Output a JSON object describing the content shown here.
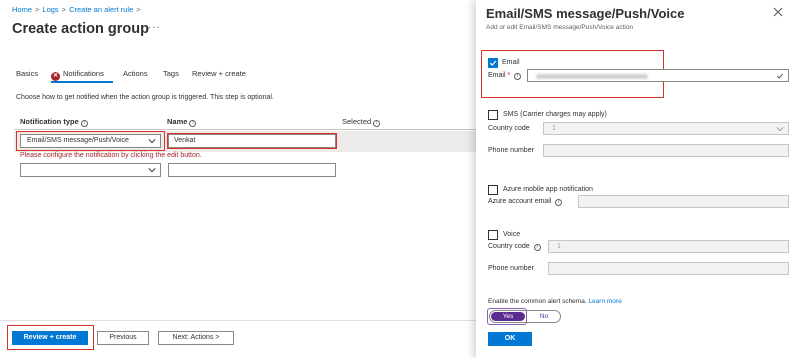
{
  "breadcrumb": {
    "items": [
      "Home",
      "Logs",
      "Create an alert rule"
    ]
  },
  "page": {
    "title": "Create action group",
    "more": "···"
  },
  "tabs": [
    {
      "label": "Basics",
      "active": false,
      "error": false
    },
    {
      "label": "Notifications",
      "active": true,
      "error": true
    },
    {
      "label": "Actions",
      "active": false,
      "error": false
    },
    {
      "label": "Tags",
      "active": false,
      "error": false
    },
    {
      "label": "Review + create",
      "active": false,
      "error": false
    }
  ],
  "notifications": {
    "description": "Choose how to get notified when the action group is triggered. This step is optional.",
    "columns": {
      "type": "Notification type",
      "name": "Name",
      "selected": "Selected"
    },
    "rows": [
      {
        "type": "Email/SMS message/Push/Voice",
        "name": "Venkat"
      },
      {
        "type": "",
        "name": ""
      }
    ],
    "error_message": "Please configure the notification by clicking the edit button."
  },
  "footer": {
    "review_create": "Review + create",
    "previous": "Previous",
    "next": "Next: Actions >"
  },
  "panel": {
    "title": "Email/SMS message/Push/Voice",
    "subtitle": "Add or edit Email/SMS message/Push/Voice action",
    "email": {
      "checkbox_label": "Email",
      "checked": true,
      "field_label": "Email",
      "required_mark": "*"
    },
    "sms": {
      "checkbox_label": "SMS (Carrier charges may apply)",
      "checked": false,
      "country_code_label": "Country code",
      "country_code_value": "1",
      "phone_label": "Phone number"
    },
    "push": {
      "checkbox_label": "Azure mobile app notification",
      "checked": false,
      "account_email_label": "Azure account email"
    },
    "voice": {
      "checkbox_label": "Voice",
      "checked": false,
      "country_code_label": "Country code",
      "country_code_value": "1",
      "phone_label": "Phone number"
    },
    "schema": {
      "label": "Enable the common alert schema.",
      "learn_more": "Learn more",
      "yes": "Yes",
      "no": "No",
      "value": "Yes"
    },
    "ok": "OK"
  },
  "colors": {
    "accent": "#0078d4",
    "error": "#a4262c",
    "highlight": "#d9312c",
    "toggle": "#5c2d91"
  },
  "icons": [
    "chevron-right-icon",
    "more-icon",
    "error-icon",
    "info-icon",
    "chevron-down-icon",
    "checkmark-icon",
    "close-icon"
  ]
}
